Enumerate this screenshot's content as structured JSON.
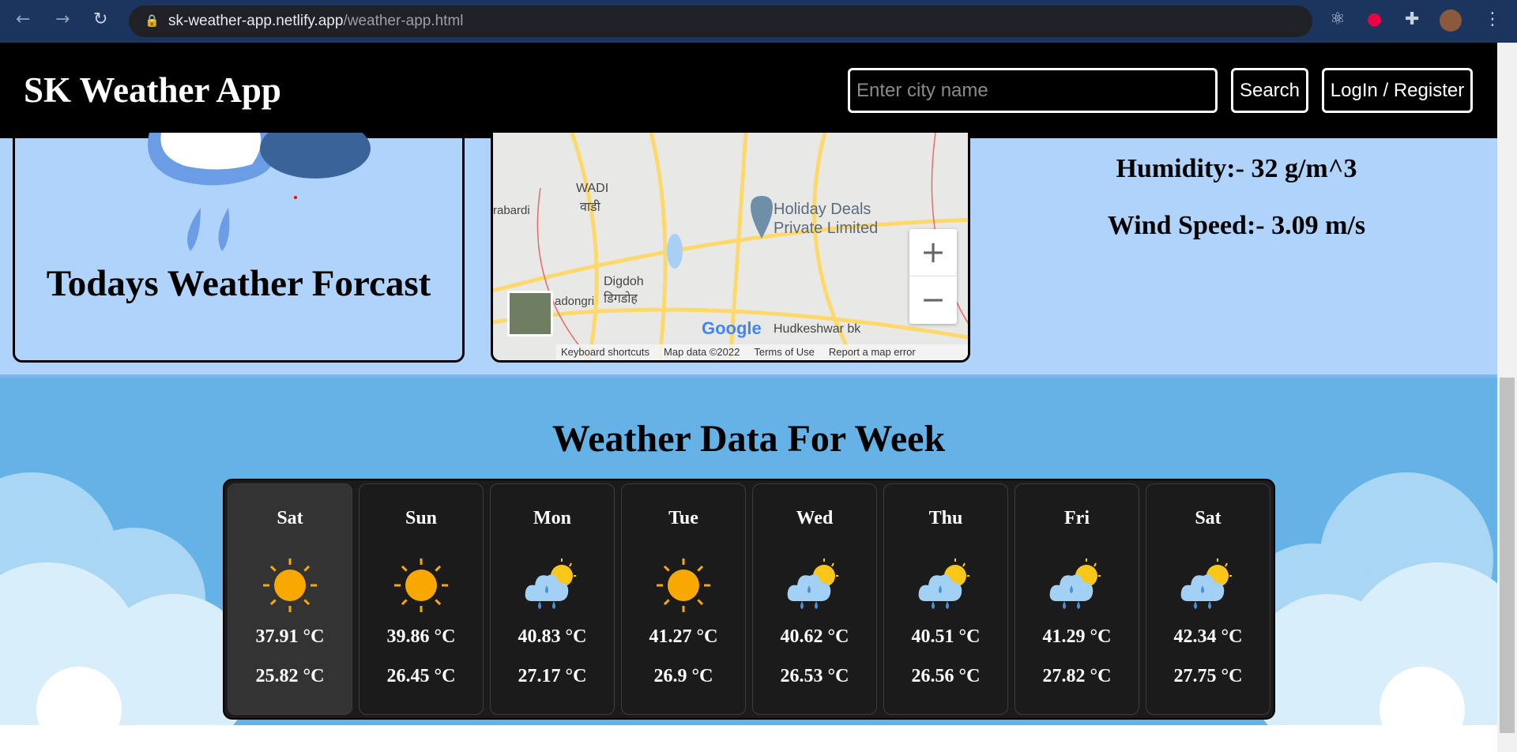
{
  "browser": {
    "url_host": "sk-weather-app.netlify.app",
    "url_path": "/weather-app.html"
  },
  "header": {
    "title": "SK Weather App",
    "search_placeholder": "Enter city name",
    "search_label": "Search",
    "login_label": "LogIn / Register"
  },
  "today": {
    "heading": "Todays Weather Forcast",
    "humidity": "Humidity:- 32 g/m^3",
    "wind": "Wind Speed:- 3.09 m/s"
  },
  "map": {
    "place": "Holiday Deals Private Limited",
    "labels": [
      "WADI",
      "वाडी",
      "Digdoh",
      "डिगडोह",
      "Hudkeshwar bk",
      "rabardi",
      "adongri"
    ],
    "attribution": [
      "Keyboard shortcuts",
      "Map data ©2022",
      "Terms of Use",
      "Report a map error"
    ],
    "google": "Google"
  },
  "week": {
    "title": "Weather Data For Week",
    "days": [
      {
        "day": "Sat",
        "icon": "sun",
        "high": "37.91 °C",
        "low": "25.82 °C"
      },
      {
        "day": "Sun",
        "icon": "sun",
        "high": "39.86 °C",
        "low": "26.45 °C"
      },
      {
        "day": "Mon",
        "icon": "rain-sun",
        "high": "40.83 °C",
        "low": "27.17 °C"
      },
      {
        "day": "Tue",
        "icon": "sun",
        "high": "41.27 °C",
        "low": "26.9 °C"
      },
      {
        "day": "Wed",
        "icon": "rain-sun",
        "high": "40.62 °C",
        "low": "26.53 °C"
      },
      {
        "day": "Thu",
        "icon": "rain-sun",
        "high": "40.51 °C",
        "low": "26.56 °C"
      },
      {
        "day": "Fri",
        "icon": "rain-sun",
        "high": "41.29 °C",
        "low": "27.82 °C"
      },
      {
        "day": "Sat",
        "icon": "rain-sun",
        "high": "42.34 °C",
        "low": "27.75 °C"
      }
    ]
  },
  "colors": {
    "header": "#000000",
    "top_bg": "#b0d3fc",
    "week_bg": "#65b3e6",
    "card_bg": "#1b1b1b",
    "sun": "#f9a800"
  }
}
